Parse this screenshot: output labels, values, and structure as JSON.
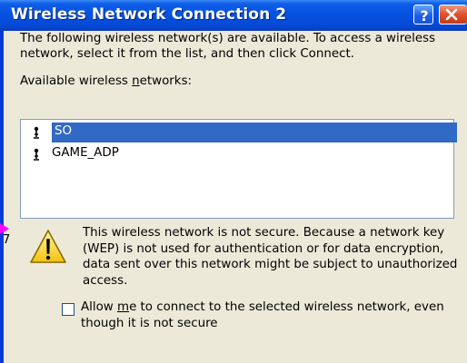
{
  "window": {
    "title": "Wireless Network Connection 2",
    "help_label": "?",
    "close_label": "X"
  },
  "intro_text": "The following wireless network(s) are available. To access a wireless network, select it from the list, and then click Connect.",
  "available_label": {
    "before": "Available wireless ",
    "mnemonic": "n",
    "after": "etworks:"
  },
  "networks": [
    {
      "name": "SO",
      "selected": true,
      "icon": "wireless-antenna-icon"
    },
    {
      "name": "GAME_ADP",
      "selected": false,
      "icon": "wireless-antenna-icon"
    }
  ],
  "warning": {
    "icon": "warning-icon",
    "text": "This wireless network is not secure. Because a network key (WEP) is not used for authentication or for data encryption, data sent over this network might be subject to unauthorized access."
  },
  "allow_checkbox": {
    "checked": false,
    "label_before": "Allow ",
    "mnemonic": "m",
    "label_after": "e to connect to the selected wireless network, even though it is not secure"
  },
  "side_marker": "7",
  "colors": {
    "title_blue": "#0552e0",
    "selection": "#316ac5",
    "dialog_bg": "#ece9d8"
  }
}
